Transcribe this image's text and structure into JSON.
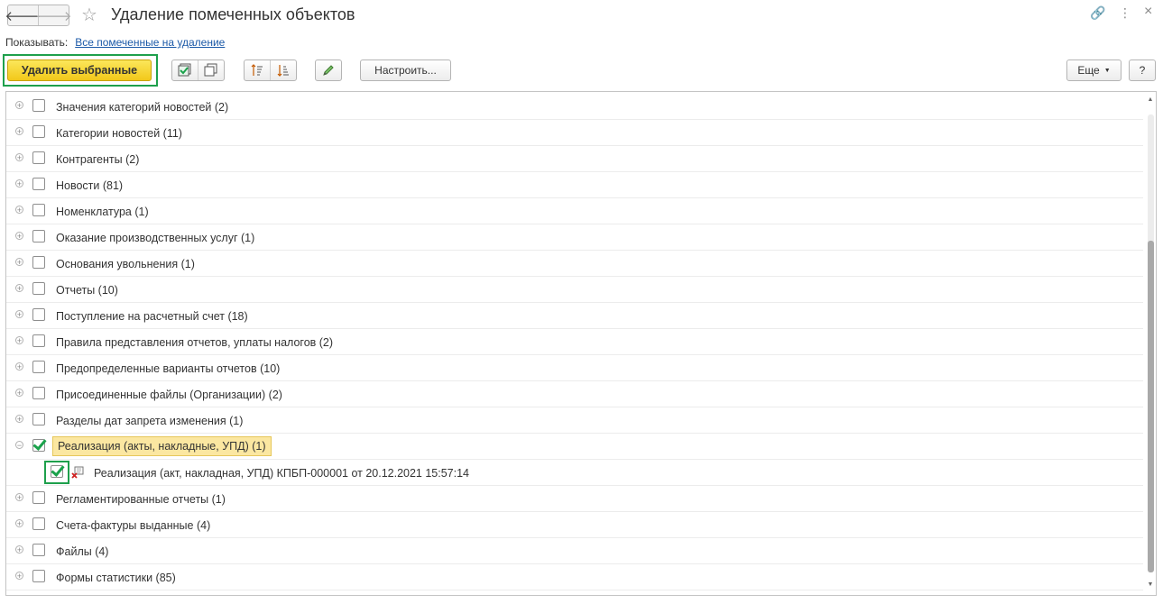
{
  "window": {
    "title": "Удаление помеченных объектов",
    "nav_back": "🡐",
    "nav_forward": "🡒",
    "star_icon": "☆",
    "link_icon": "🔗",
    "more_icon": "⋮",
    "close_icon": "×"
  },
  "filter": {
    "label": "Показывать:",
    "link": "Все помеченные на удаление"
  },
  "toolbar": {
    "delete_selected": "Удалить выбранные",
    "configure": "Настроить...",
    "more": "Еще",
    "help": "?"
  },
  "rows": [
    {
      "label": "Значения категорий новостей (2)",
      "checked": false
    },
    {
      "label": "Категории новостей (11)",
      "checked": false
    },
    {
      "label": "Контрагенты (2)",
      "checked": false
    },
    {
      "label": "Новости (81)",
      "checked": false
    },
    {
      "label": "Номенклатура (1)",
      "checked": false
    },
    {
      "label": "Оказание производственных услуг (1)",
      "checked": false
    },
    {
      "label": "Основания увольнения (1)",
      "checked": false
    },
    {
      "label": "Отчеты (10)",
      "checked": false
    },
    {
      "label": "Поступление на расчетный счет (18)",
      "checked": false
    },
    {
      "label": "Правила представления отчетов, уплаты налогов (2)",
      "checked": false
    },
    {
      "label": "Предопределенные варианты отчетов (10)",
      "checked": false
    },
    {
      "label": "Присоединенные файлы (Организации) (2)",
      "checked": false
    },
    {
      "label": "Разделы дат запрета изменения (1)",
      "checked": false
    },
    {
      "label": "Реализация (акты, накладные, УПД) (1)",
      "checked": true
    },
    {
      "label": "Реализация (акт, накладная, УПД) КПБП-000001 от 20.12.2021 15:57:14",
      "checked": true
    },
    {
      "label": "Регламентированные отчеты (1)",
      "checked": false
    },
    {
      "label": "Счета-фактуры выданные (4)",
      "checked": false
    },
    {
      "label": "Файлы (4)",
      "checked": false
    },
    {
      "label": "Формы статистики (85)",
      "checked": false
    }
  ],
  "colors": {
    "accent_yellow": "#f2c81a",
    "highlight_green": "#1ea04c",
    "selected_row": "#fbe7a1",
    "link_blue": "#1c5aa8"
  }
}
